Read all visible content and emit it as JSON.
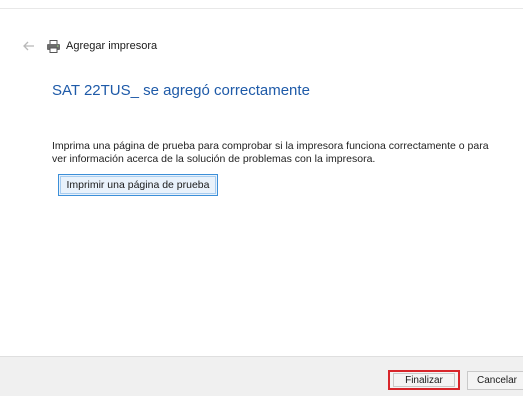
{
  "window": {
    "title": "Agregar impresora",
    "back_icon": "back-arrow-icon",
    "title_icon": "printer-icon"
  },
  "main": {
    "heading": "SAT 22TUS_ se agregó correctamente",
    "description": "Imprima una página de prueba para comprobar si la impresora funciona correctamente o para ver información acerca de la solución de problemas con la impresora.",
    "test_page_button": "Imprimir una página de prueba"
  },
  "footer": {
    "finish_button": "Finalizar",
    "cancel_button": "Cancelar"
  },
  "colors": {
    "heading": "#1e5aa8",
    "highlight_border": "#d8262b",
    "button_focus_border": "#3c8fd8",
    "footer_background": "#f0f0f0"
  }
}
